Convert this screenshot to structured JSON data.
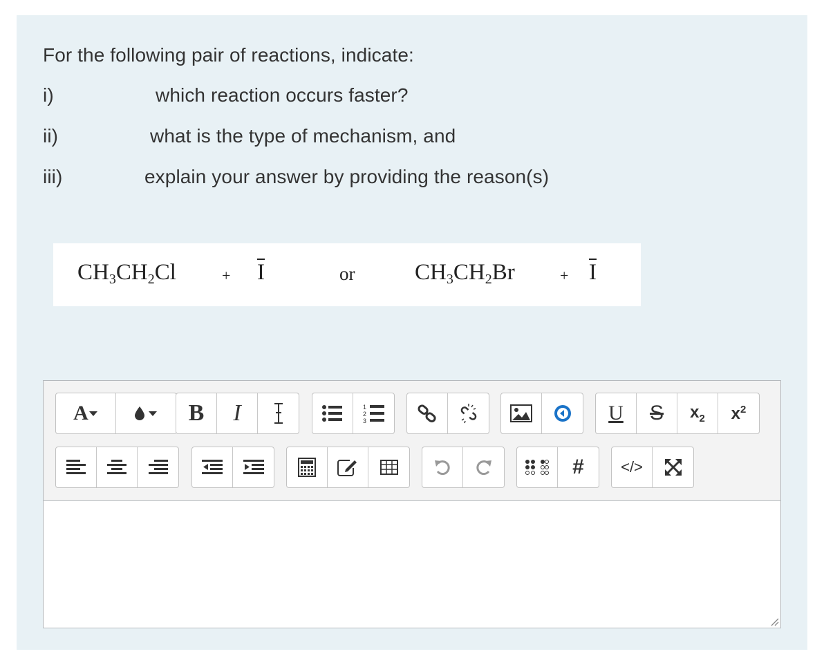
{
  "question": {
    "intro": "For the following pair of reactions, indicate:",
    "items": [
      {
        "num": "i)",
        "text": "which reaction occurs faster?"
      },
      {
        "num": "ii)",
        "text": "what is the type of mechanism, and"
      },
      {
        "num": "iii)",
        "text": "explain your answer by providing the reason(s)"
      }
    ]
  },
  "reaction": {
    "r1_a": "CH",
    "r1_s1": "3",
    "r1_b": "CH",
    "r1_s2": "2",
    "r1_c": "Cl",
    "plus": "+",
    "nucleophile": "I",
    "or": "or",
    "r2_a": "CH",
    "r2_s1": "3",
    "r2_b": "CH",
    "r2_s2": "2",
    "r2_c": "Br"
  },
  "toolbar": {
    "font_color": "A",
    "bold": "B",
    "italic": "I",
    "underline": "U",
    "strike": "S",
    "sub_base": "x",
    "sub_script": "2",
    "sup_base": "x",
    "sup_script": "2",
    "hash": "#",
    "html": "</>"
  },
  "colors": {
    "panel_bg": "#e8f1f5",
    "accent_blue": "#1a73c8"
  },
  "answer": {
    "value": ""
  }
}
